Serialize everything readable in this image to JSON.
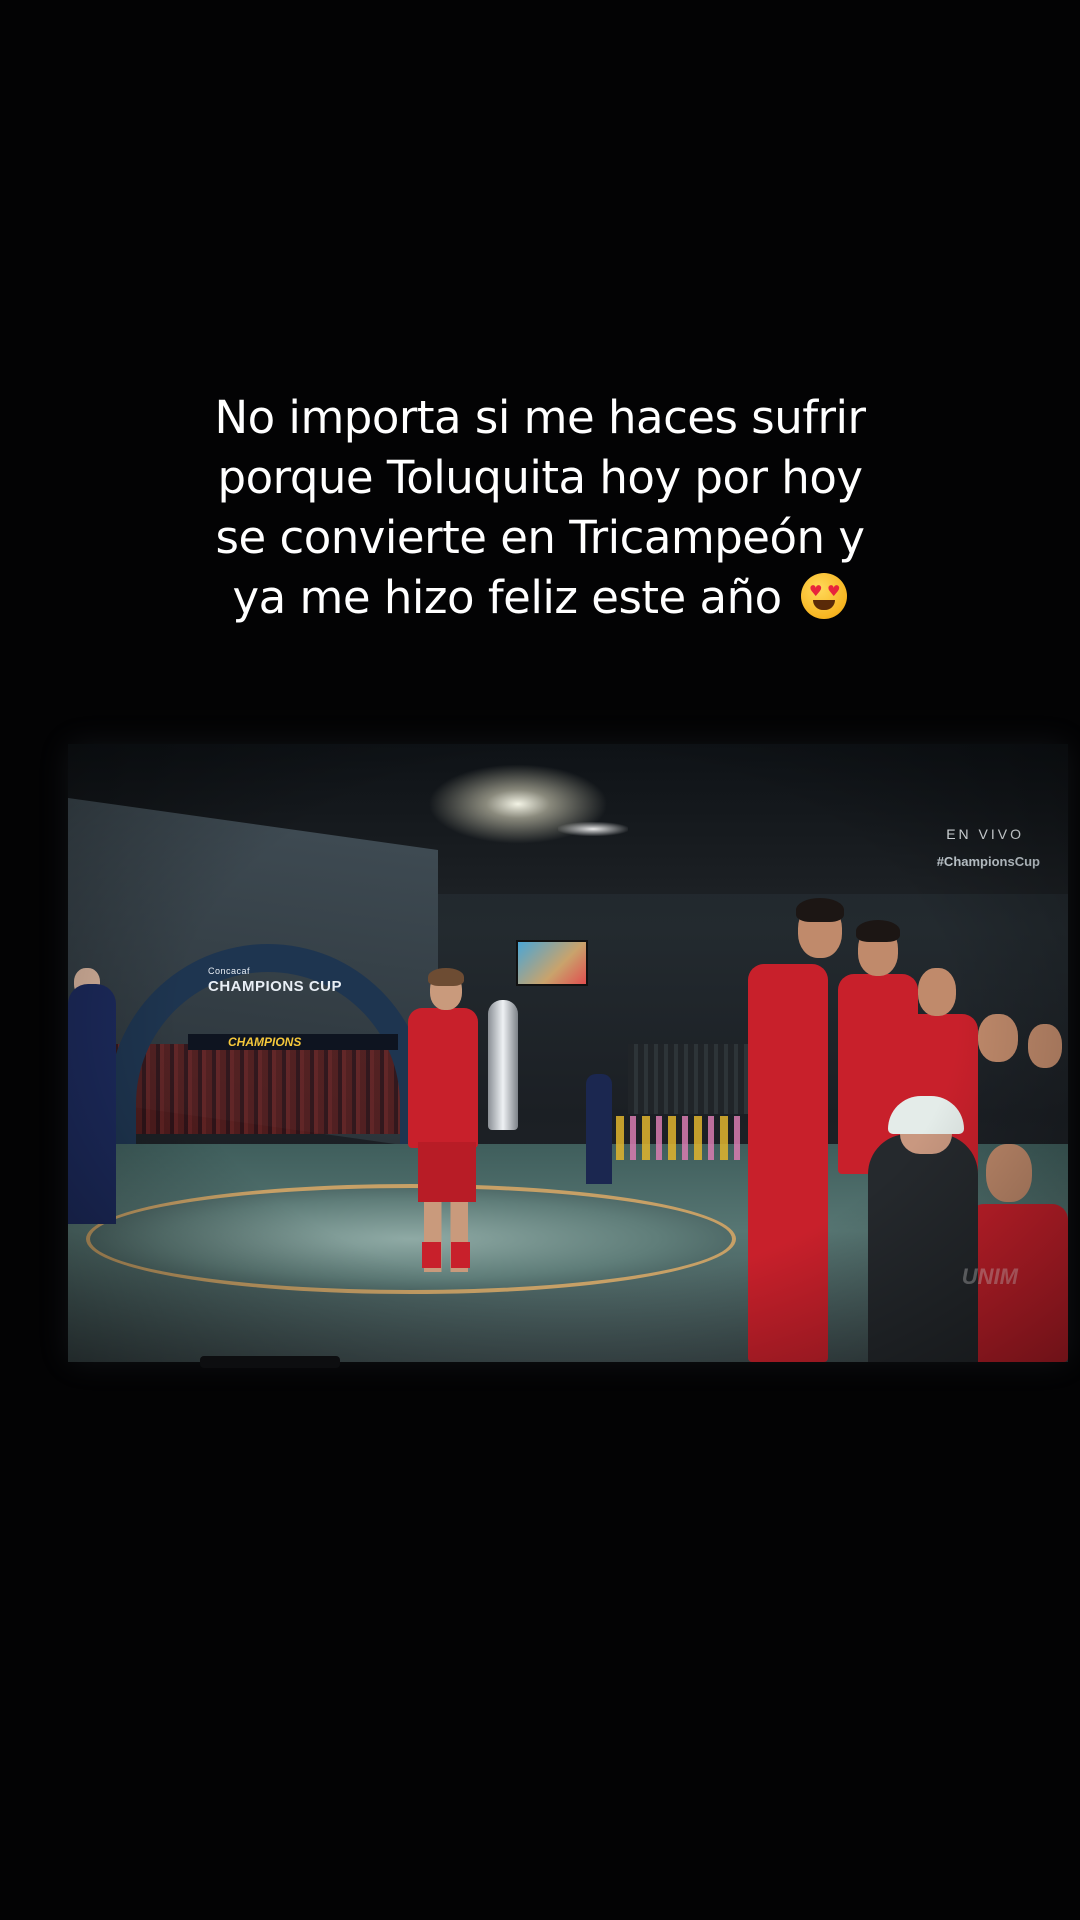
{
  "caption": {
    "lines": [
      "No importa si me haces sufrir",
      "porque Toluquita hoy por hoy",
      "se convierte en Tricampeón y",
      "ya me hizo feliz este año"
    ],
    "emoji": "smiling-face-with-heart-eyes"
  },
  "video": {
    "overlay_live": "EN VIVO",
    "overlay_hashtag": "#ChampionsCup",
    "watermark": "UNIM",
    "arch_brand_small": "Concacaf",
    "arch_brand": "CHAMPIONS CUP",
    "banner_text": "CHAMPIONS"
  },
  "colors": {
    "background": "#030304",
    "caption_text": "#ffffff",
    "kit_red": "#c8202b"
  }
}
